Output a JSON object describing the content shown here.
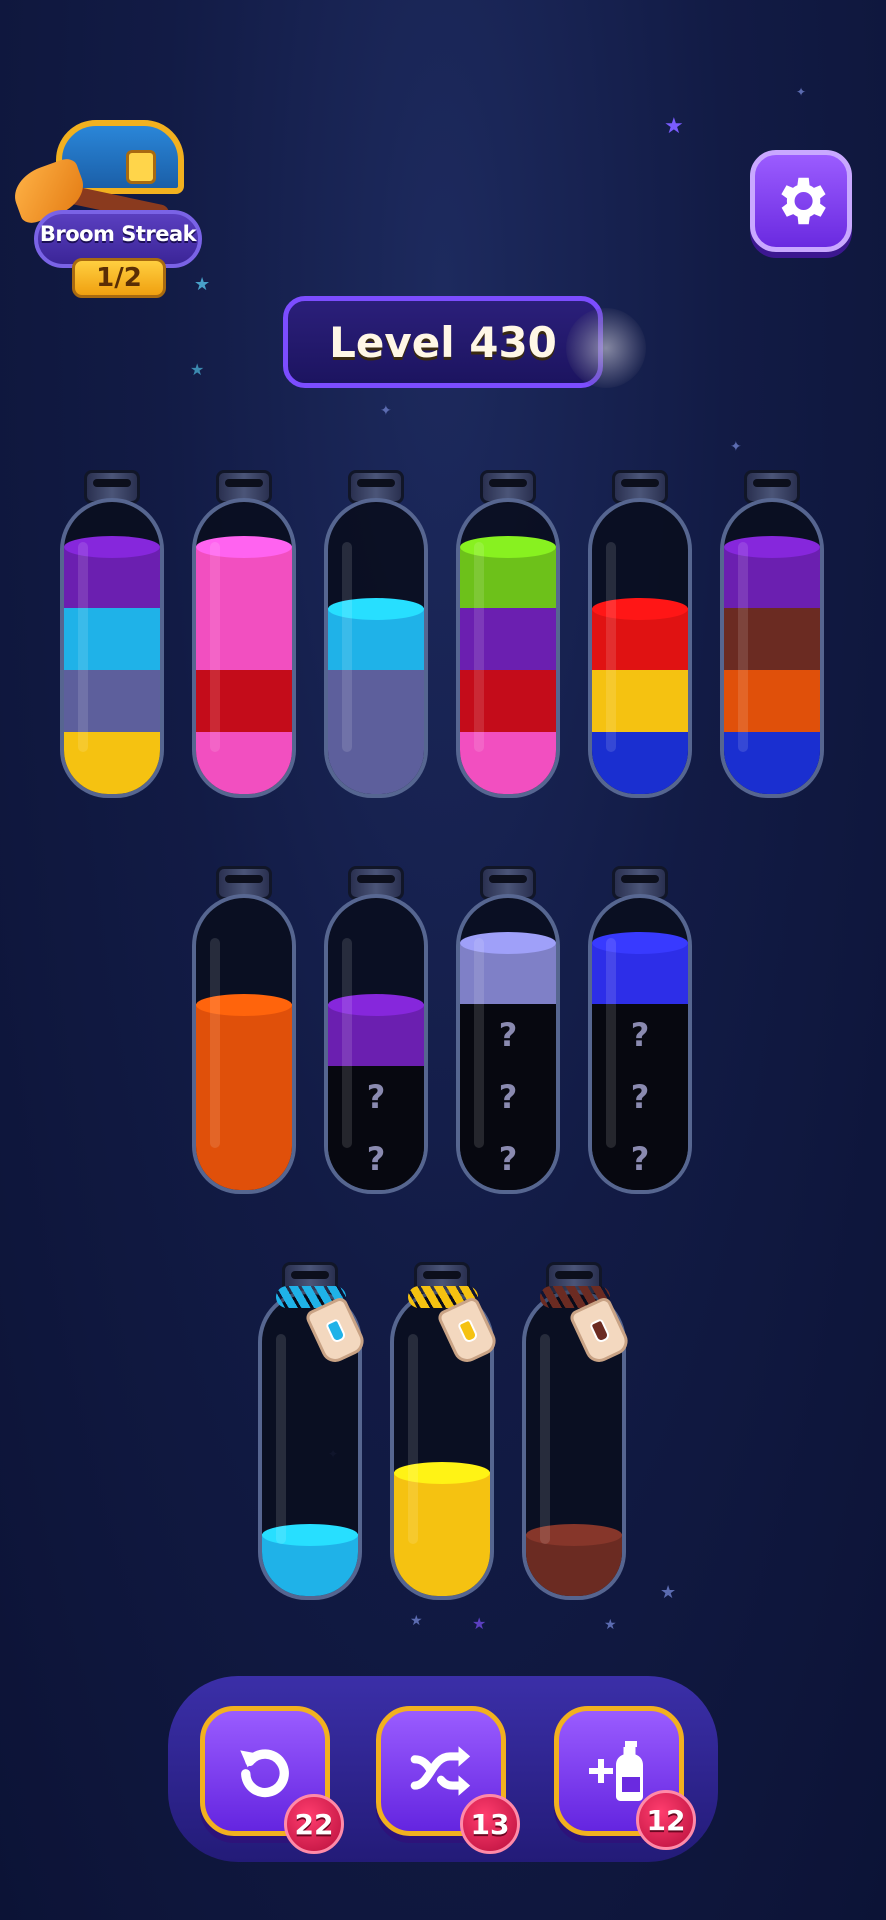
{
  "streak": {
    "title": "Broom Streak",
    "progress": "1/2",
    "icon": "treasure-chest-icon"
  },
  "settings": {
    "icon": "gear-icon"
  },
  "level": {
    "label": "Level 430"
  },
  "colors": {
    "purple": "#6b1fb0",
    "cyan": "#1fb2e8",
    "slate": "#5d5f9c",
    "yellow": "#f5c211",
    "pink": "#f24fc0",
    "red": "#c40c1a",
    "bright_red": "#e01212",
    "green": "#6dc11a",
    "brown": "#6b2b22",
    "orange": "#e0500a",
    "blue": "#1a2fd0",
    "lavender": "#7f80c7",
    "royal": "#2d2ee8"
  },
  "mystery_symbol": "?",
  "tubes_row1": [
    {
      "layers": [
        "yellow",
        "slate",
        "cyan",
        "purple"
      ]
    },
    {
      "layers": [
        "pink",
        "red",
        "pink",
        "pink"
      ]
    },
    {
      "layers": [
        "slate",
        "slate",
        "cyan"
      ]
    },
    {
      "layers": [
        "pink",
        "red",
        "purple",
        "green"
      ]
    },
    {
      "layers": [
        "blue",
        "yellow",
        "bright_red"
      ]
    },
    {
      "layers": [
        "blue",
        "orange",
        "brown",
        "purple"
      ]
    }
  ],
  "tubes_row2": [
    {
      "layers": [
        "orange",
        "orange",
        "orange"
      ]
    },
    {
      "layers": [
        "?",
        "?",
        "purple"
      ]
    },
    {
      "layers": [
        "?",
        "?",
        "?",
        "lavender"
      ]
    },
    {
      "layers": [
        "?",
        "?",
        "?",
        "royal"
      ]
    }
  ],
  "tubes_row3": [
    {
      "layers": [
        "cyan"
      ],
      "lock_color": "cyan"
    },
    {
      "layers": [
        "yellow",
        "yellow"
      ],
      "lock_color": "yellow"
    },
    {
      "layers": [
        "brown"
      ],
      "lock_color": "brown"
    }
  ],
  "tools": [
    {
      "name": "undo",
      "icon": "undo-icon",
      "count": "22"
    },
    {
      "name": "shuffle",
      "icon": "shuffle-icon",
      "count": "13"
    },
    {
      "name": "add-tube",
      "icon": "add-tube-icon",
      "count": "12"
    }
  ]
}
